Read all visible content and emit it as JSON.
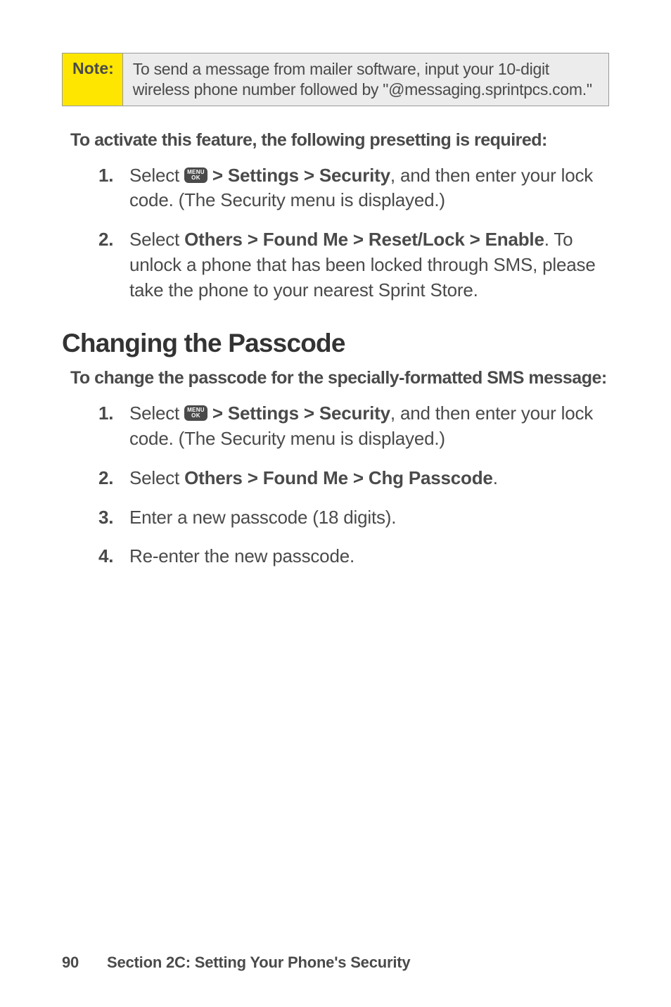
{
  "note": {
    "label": "Note:",
    "body": "To send a message from mailer software, input your 10-digit wireless phone number followed by \"@messaging.sprintpcs.com.\""
  },
  "activate": {
    "heading": "To activate this feature, the following presetting is required:",
    "items": [
      {
        "num": "1.",
        "pre": "Select ",
        "bold": " > Settings > Security",
        "post": ", and then enter your lock code. (The Security menu is displayed.)"
      },
      {
        "num": "2.",
        "pre": "Select ",
        "bold": "Others > Found Me > Reset/Lock > Enable",
        "post": ". To unlock a phone that has been locked through SMS, please take the phone to your nearest Sprint Store."
      }
    ]
  },
  "changing": {
    "title": "Changing the Passcode",
    "heading": "To change the passcode for the specially-formatted SMS message:",
    "items": [
      {
        "num": "1.",
        "pre": "Select ",
        "bold": " > Settings > Security",
        "post": ", and then enter your lock code. (The Security menu is displayed.)"
      },
      {
        "num": "2.",
        "pre": "Select ",
        "bold": "Others > Found Me > Chg Passcode",
        "post": "."
      },
      {
        "num": "3.",
        "text": "Enter a new passcode (18 digits)."
      },
      {
        "num": "4.",
        "text": "Re-enter the new passcode."
      }
    ]
  },
  "menu_key": {
    "line1": "MENU",
    "line2": "OK"
  },
  "footer": {
    "page": "90",
    "section": "Section 2C: Setting Your Phone's Security"
  }
}
